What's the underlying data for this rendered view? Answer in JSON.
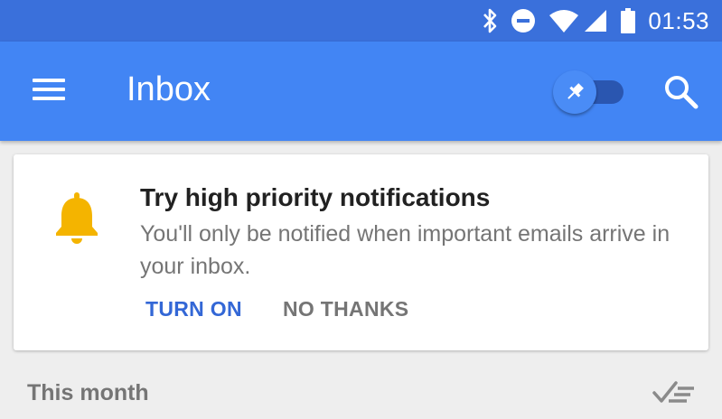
{
  "status_bar": {
    "time": "01:53",
    "icons": [
      "bluetooth-icon",
      "do-not-disturb-icon",
      "wifi-icon",
      "cell-signal-icon",
      "battery-icon"
    ]
  },
  "app_bar": {
    "title": "Inbox",
    "icons": [
      "menu-icon",
      "pin-icon",
      "search-icon"
    ],
    "colors": {
      "status_bar": "#3a70db",
      "app_bar": "#4285f4"
    }
  },
  "notification_card": {
    "icon": "bell-icon",
    "title": "Try high priority notifications",
    "body": "You'll only be notified when important emails arrive in your inbox.",
    "turn_on_label": "TURN ON",
    "no_thanks_label": "NO THANKS",
    "colors": {
      "bell": "#f4b400",
      "primary_button": "#3367d6"
    }
  },
  "section": {
    "title": "This month",
    "action_icon": "sweep-done-icon"
  }
}
